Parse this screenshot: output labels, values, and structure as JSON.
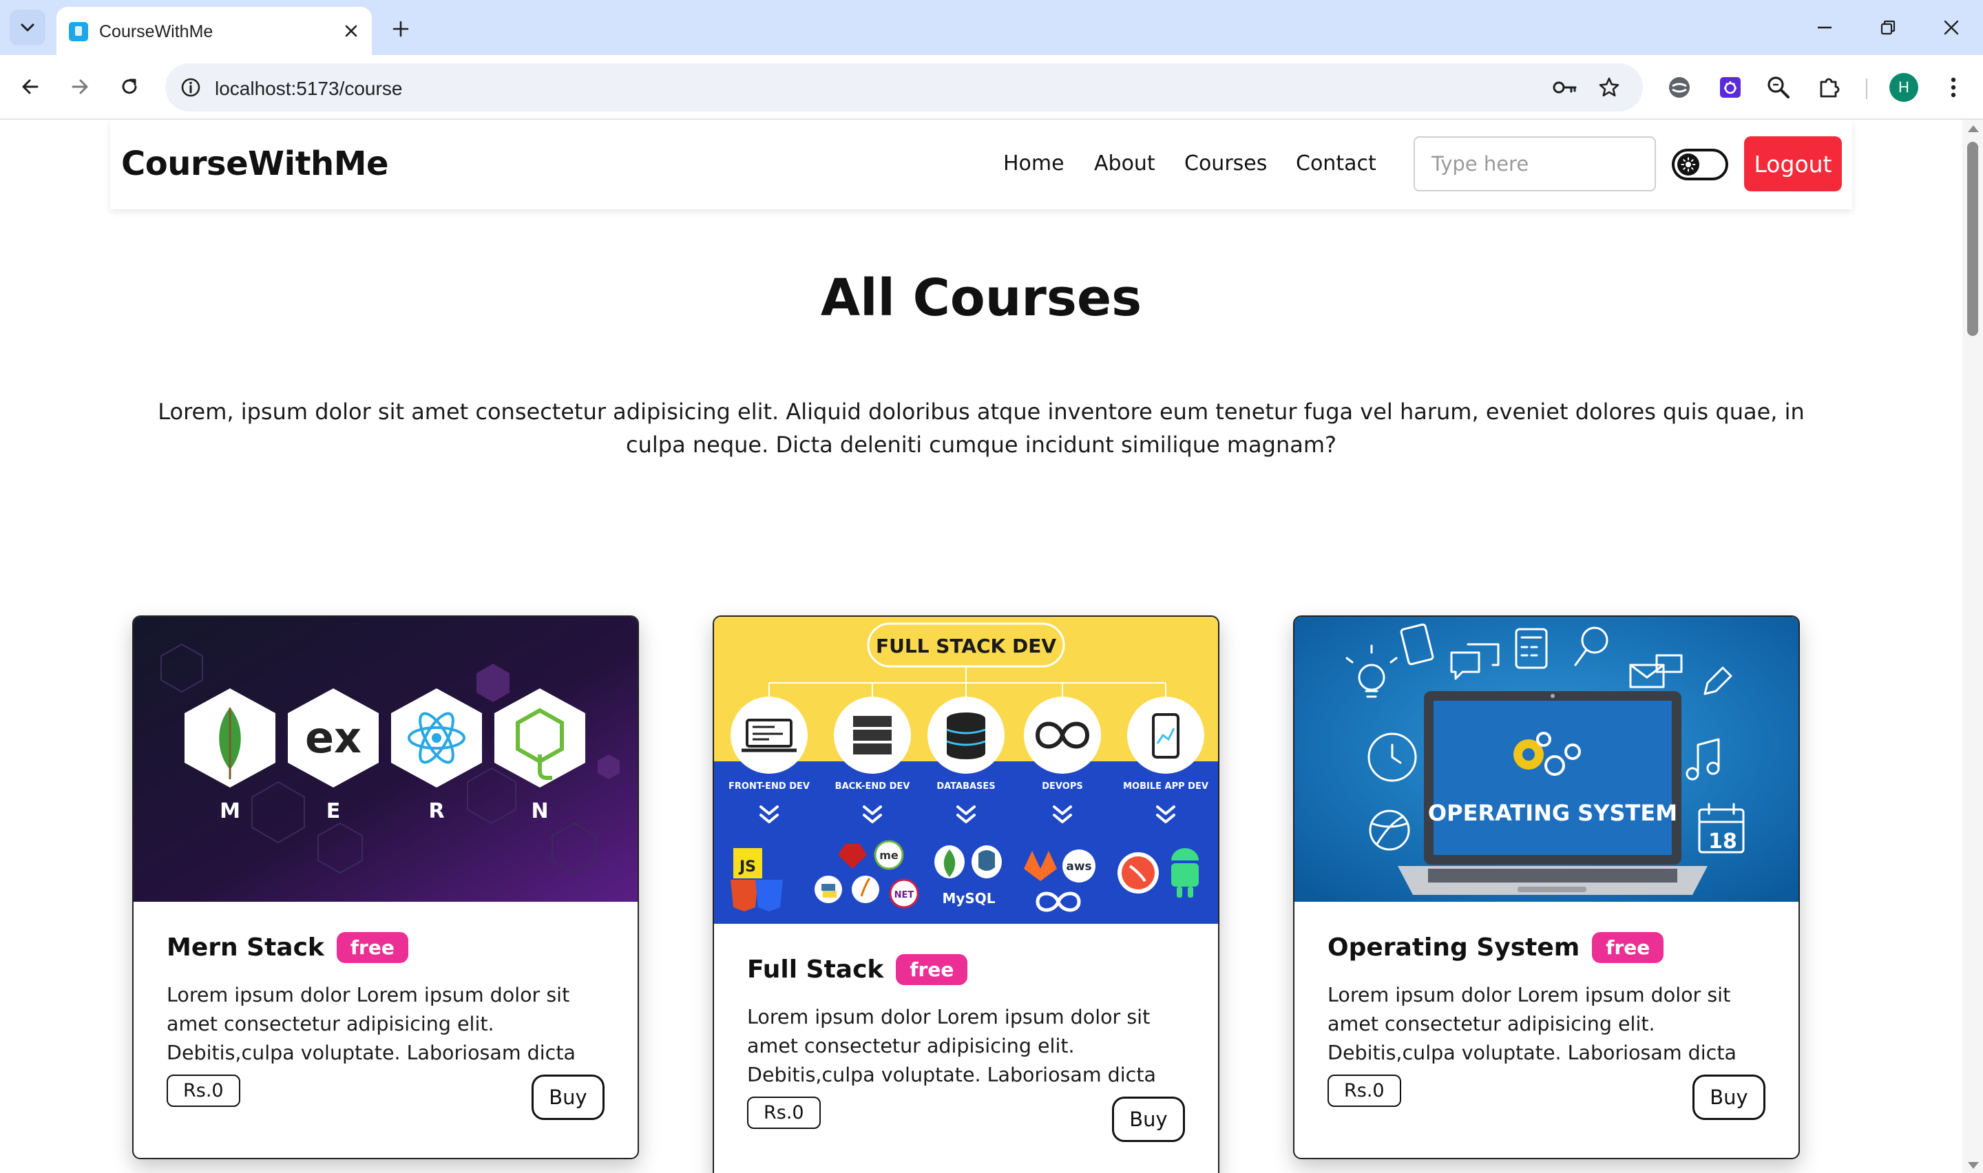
{
  "browser": {
    "tab_title": "CourseWithMe",
    "url": "localhost:5173/course",
    "profile_initial": "H"
  },
  "site": {
    "brand": "CourseWithMe",
    "nav": [
      "Home",
      "About",
      "Courses",
      "Contact"
    ],
    "search_placeholder": "Type here",
    "logout_label": "Logout"
  },
  "page": {
    "title": "All Courses",
    "intro": "Lorem, ipsum dolor sit amet consectetur adipisicing elit. Aliquid doloribus atque inventore eum tenetur fuga vel harum, eveniet dolores quis quae, in culpa neque. Dicta deleniti cumque incidunt similique magnam?"
  },
  "courses": [
    {
      "title": "Mern Stack",
      "badge": "free",
      "description": "Lorem ipsum dolor Lorem ipsum dolor sit amet consectetur adipisicing elit. Debitis,culpa voluptate. Laboriosam dicta",
      "price": "Rs.0",
      "buy_label": "Buy",
      "image_letters": [
        "M",
        "E",
        "R",
        "N"
      ],
      "image_hex_labels": [
        "ex"
      ]
    },
    {
      "title": "Full Stack",
      "badge": "free",
      "description": "Lorem ipsum dolor Lorem ipsum dolor sit amet consectetur adipisicing elit. Debitis,culpa voluptate. Laboriosam dicta",
      "price": "Rs.0",
      "buy_label": "Buy",
      "image_heading": "FULL STACK DEV",
      "image_columns": [
        "FRONT-END DEV",
        "BACK-END DEV",
        "DATABASES",
        "DEVOPS",
        "MOBILE APP DEV"
      ],
      "image_logo_texts": [
        "JS",
        "me",
        "NET",
        "aws",
        "MySQL"
      ]
    },
    {
      "title": "Operating System",
      "badge": "free",
      "description": "Lorem ipsum dolor Lorem ipsum dolor sit amet consectetur adipisicing elit. Debitis,culpa voluptate. Laboriosam dicta",
      "price": "Rs.0",
      "buy_label": "Buy",
      "image_screen_text": "OPERATING SYSTEM",
      "image_calendar_text": "18"
    }
  ],
  "colors": {
    "logout": "#f42a3a",
    "badge": "#ec2f95",
    "tabstrip": "#d3e3fd"
  },
  "icons": [
    "tab-search-icon",
    "close-icon",
    "plus-icon",
    "minimize-icon",
    "restore-icon",
    "back-arrow-icon",
    "forward-arrow-icon",
    "reload-icon",
    "info-icon",
    "key-icon",
    "star-icon",
    "extension-icon",
    "search-icon",
    "puzzle-icon",
    "more-vert-icon",
    "sun-icon"
  ]
}
